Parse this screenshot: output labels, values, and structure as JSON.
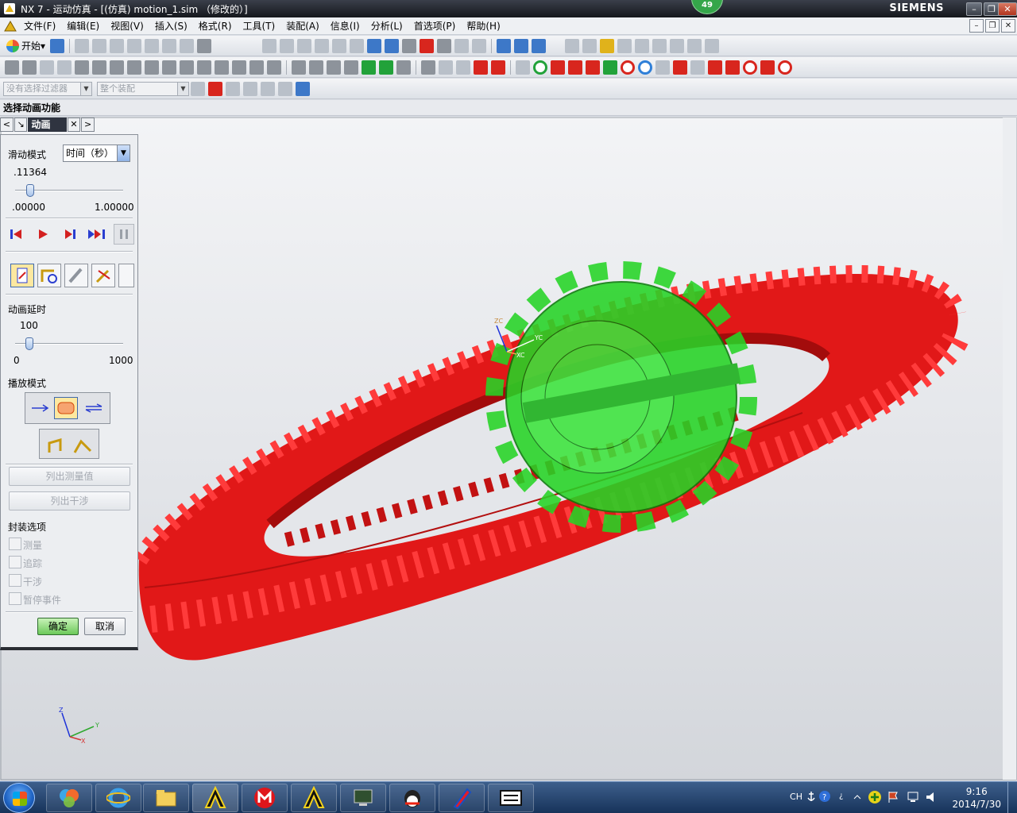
{
  "window": {
    "title": "NX 7 - 运动仿真 - [(仿真) motion_1.sim （修改的）]",
    "brand": "SIEMENS",
    "badge": "49"
  },
  "menu": [
    "文件(F)",
    "编辑(E)",
    "视图(V)",
    "插入(S)",
    "格式(R)",
    "工具(T)",
    "装配(A)",
    "信息(I)",
    "分析(L)",
    "首选项(P)",
    "帮助(H)"
  ],
  "toolbar": {
    "start_label": "开始",
    "filter_placeholder": "没有选择过滤器",
    "scope_placeholder": "整个装配"
  },
  "cue_line": "选择动画功能",
  "dialog": {
    "tab_label": "动画",
    "slide_mode_label": "滑动模式",
    "slide_mode_value": "时间（秒）",
    "time_value": ".11364",
    "time_fraction": 0.11364,
    "time_min": ".00000",
    "time_max": "1.00000",
    "delay_label": "动画延时",
    "delay_value": "100",
    "delay_fraction": 0.1,
    "delay_min": "0",
    "delay_max": "1000",
    "play_mode_label": "播放模式",
    "list_measure_button": "列出测量值",
    "list_interference_button": "列出干涉",
    "package_options_label": "封装选项",
    "checkboxes": [
      "测量",
      "追踪",
      "干涉",
      "暂停事件"
    ],
    "ok_button": "确定",
    "cancel_button": "取消"
  },
  "viewport": {
    "gear_ring_color": "#ee1c1c",
    "pinion_color": "#22d822",
    "wcs_labels": [
      "ZC",
      "YC",
      "XC"
    ],
    "triad_labels": [
      "Z",
      "Y",
      "X"
    ]
  },
  "taskbar": {
    "lang": "CH",
    "time": "9:16",
    "date": "2014/7/30"
  }
}
